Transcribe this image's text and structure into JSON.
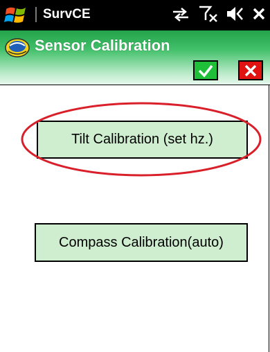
{
  "statusbar": {
    "app_name": "SurvCE",
    "icons": [
      "windows-logo-icon",
      "connectivity-arrows-icon",
      "no-signal-icon",
      "volume-icon",
      "close-icon"
    ]
  },
  "titlebar": {
    "title": "Sensor Calibration",
    "icon": "app-compass-icon",
    "ok_icon": "checkmark-icon",
    "cancel_icon": "x-icon"
  },
  "main": {
    "tilt_button_label": "Tilt Calibration (set hz.)",
    "compass_button_label": "Compass Calibration(auto)"
  },
  "colors": {
    "titlebar_green": "#2eae52",
    "button_fill": "#cfeecf",
    "ok_green": "#1fbf3a",
    "cancel_red": "#e01212",
    "annotation_red": "#d9202a"
  }
}
